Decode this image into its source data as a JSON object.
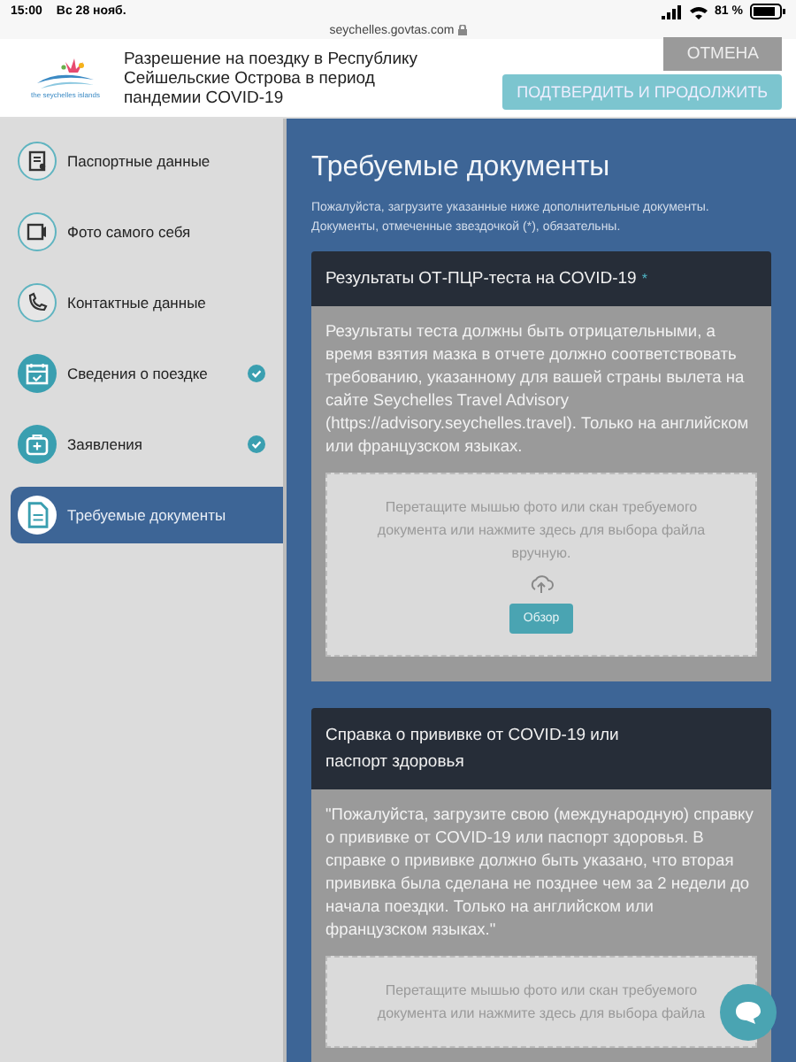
{
  "status_bar": {
    "time": "15:00",
    "date": "Вс 28 нояб.",
    "battery": "81 %"
  },
  "url_bar": {
    "address": "seychelles.govtas.com"
  },
  "header": {
    "logo_text": "the seychelles islands",
    "title": "Разрешение на поездку в Республику Сейшельские Острова в период пандемии COVID-19",
    "buttons": [
      {
        "label": "ОТМЕНА",
        "kind": "cancel"
      },
      {
        "label": "ПОДТВЕРДИТЬ И ПРОДОЛЖИТЬ",
        "kind": "confirm"
      }
    ]
  },
  "sidebar": {
    "items": [
      {
        "label": "Паспортные данные",
        "done": false,
        "selected": false
      },
      {
        "label": "Фото самого себя",
        "done": false,
        "selected": false
      },
      {
        "label": "Контактные данные",
        "done": false,
        "selected": false
      },
      {
        "label": "Сведения о поездке",
        "done": true,
        "selected": false
      },
      {
        "label": "Заявления",
        "done": true,
        "selected": false
      },
      {
        "label": "Требуемые документы",
        "done": false,
        "selected": true
      }
    ]
  },
  "main": {
    "title": "Требуемые документы",
    "intro": "Пожалуйста, загрузите указанные ниже дополнительные документы. Документы, отмеченные звездочкой (*), обязательны.",
    "documents": [
      {
        "title": "Результаты ОТ-ПЦР-теста на COVID-19",
        "required_mark": "*",
        "description": "Результаты теста должны быть отрицательными, а время взятия мазка в отчете должно соответствовать требованию, указанному для вашей страны вылета на сайте Seychelles Travel Advisory (https://advisory.seychelles.travel). Только на английском или французском языках.",
        "dropzone": "Перетащите мышью фото или скан требуемого документа или нажмите здесь для выбора файла вручную.",
        "browse": "Обзор"
      },
      {
        "title": "Справка о прививке от COVID-19 или паспорт здоровья",
        "description": "\"Пожалуйста, загрузите свою (международную) справку о прививке от COVID-19 или паспорт здоровья. В справке о прививке должно быть указано, что вторая прививка была сделана не позднее чем за 2 недели до начала поездки. Только на английском или французском языках.\"",
        "dropzone": "Перетащите мышью фото или скан требуемого документа или нажмите здесь для выбора файла"
      }
    ]
  }
}
